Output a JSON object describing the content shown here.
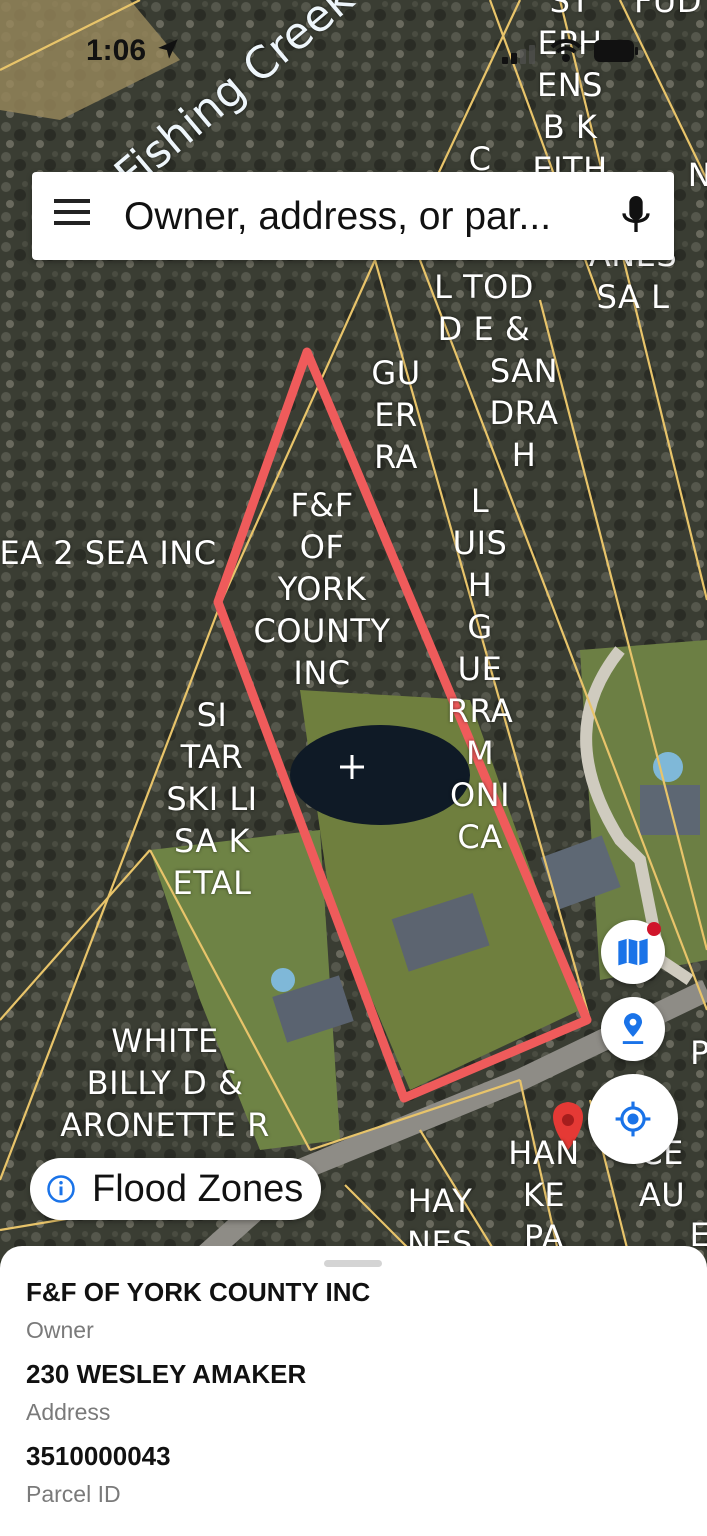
{
  "status_bar": {
    "time": "1:06"
  },
  "search": {
    "placeholder": "Owner, address, or par..."
  },
  "map": {
    "creek_label": "Fishing Creek",
    "owner_labels": {
      "label_1": "ST\nEPH\nENS\nB K\nEITH",
      "label_2": "FUD",
      "label_3": "C",
      "label_4": "ANES\nSA L",
      "label_5": "L TOD\nD E &",
      "label_6": "GU\nER\nRA",
      "label_7": "SAN\nDRA\nH",
      "label_8": "F&F\nOF\nYORK\nCOUNTY\nINC",
      "label_9": "L\nUIS\nH\nG\nUE\nRRA\nM\nONI\nCA",
      "label_10": "EA 2 SEA INC",
      "label_11": "SI\nTAR\nSKI LI\nSA K\nETAL",
      "label_12": "WHITE\nBILLY D &\nARONETTE R",
      "label_13": "HAN\nKE\nPA",
      "label_14": "HAY\nNES",
      "label_15": "CE\nAU",
      "label_16": "P",
      "label_17": "E",
      "label_18": "N"
    }
  },
  "flood_zones": {
    "label": "Flood Zones"
  },
  "buttons": {
    "map_layers": "map-icon",
    "pin": "location-pin-icon",
    "locate": "crosshair-icon"
  },
  "parcel": {
    "owner_value": "F&F OF YORK COUNTY INC",
    "owner_caption": "Owner",
    "address_value": "230 WESLEY AMAKER",
    "address_caption": "Address",
    "parcel_value": "3510000043",
    "parcel_caption": "Parcel ID"
  },
  "colors": {
    "parcel_outline": "#ef5b5b",
    "boundary_lines": "#e8c46a",
    "accent_blue": "#1a73e8",
    "marker_red": "#e53935"
  }
}
